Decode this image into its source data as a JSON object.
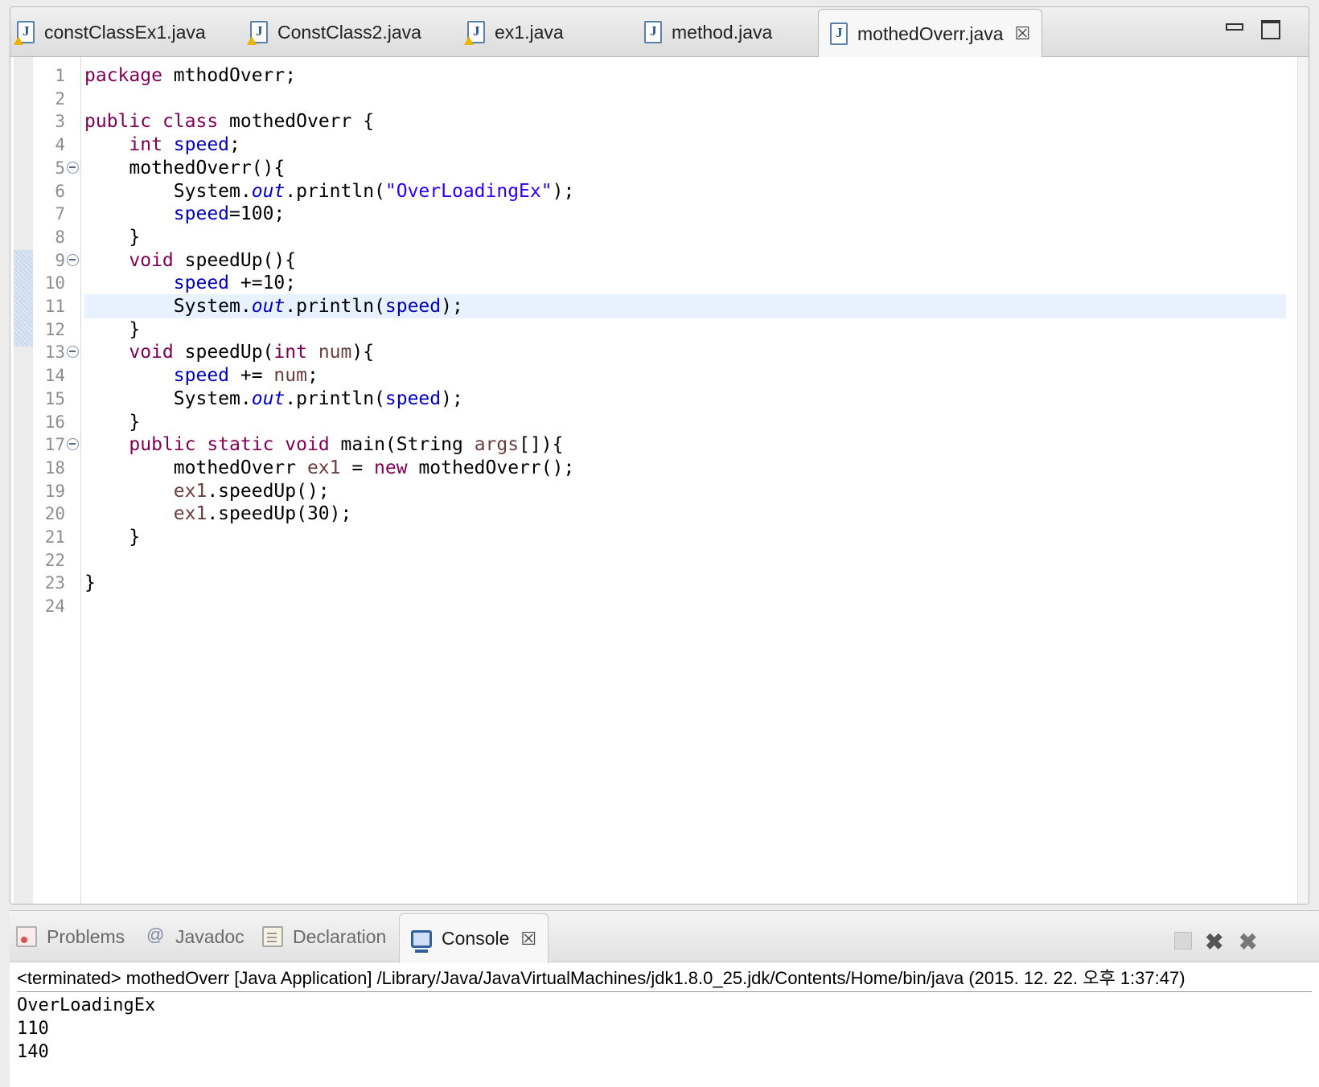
{
  "editor": {
    "tabs": [
      {
        "label": "constClassEx1.java",
        "warning": true
      },
      {
        "label": "ConstClass2.java",
        "warning": true
      },
      {
        "label": "ex1.java",
        "warning": true
      },
      {
        "label": "method.java",
        "warning": false
      },
      {
        "label": "mothedOverr.java",
        "active": true
      }
    ],
    "close_glyph": "☒",
    "current_line": 11,
    "line_numbers": [
      "1",
      "2",
      "3",
      "4",
      "5",
      "6",
      "7",
      "8",
      "9",
      "10",
      "11",
      "12",
      "13",
      "14",
      "15",
      "16",
      "17",
      "18",
      "19",
      "20",
      "21",
      "22",
      "23",
      "24"
    ],
    "folded_lines": [
      5,
      9,
      13,
      17
    ],
    "code": [
      [
        {
          "t": "package",
          "c": "kw"
        },
        {
          "t": " mthodOverr;"
        }
      ],
      [],
      [
        {
          "t": "public",
          "c": "kw"
        },
        {
          "t": " "
        },
        {
          "t": "class",
          "c": "kw"
        },
        {
          "t": " mothedOverr {"
        }
      ],
      [
        {
          "t": "    "
        },
        {
          "t": "int",
          "c": "kw"
        },
        {
          "t": " "
        },
        {
          "t": "speed",
          "c": "fld"
        },
        {
          "t": ";"
        }
      ],
      [
        {
          "t": "    mothedOverr(){"
        }
      ],
      [
        {
          "t": "        System."
        },
        {
          "t": "out",
          "c": "sfld"
        },
        {
          "t": ".println("
        },
        {
          "t": "\"OverLoadingEx\"",
          "c": "str"
        },
        {
          "t": ");"
        }
      ],
      [
        {
          "t": "        "
        },
        {
          "t": "speed",
          "c": "fld"
        },
        {
          "t": "=100;"
        }
      ],
      [
        {
          "t": "    }"
        }
      ],
      [
        {
          "t": "    "
        },
        {
          "t": "void",
          "c": "kw"
        },
        {
          "t": " speedUp(){"
        }
      ],
      [
        {
          "t": "        "
        },
        {
          "t": "speed",
          "c": "fld"
        },
        {
          "t": " +=10;"
        }
      ],
      [
        {
          "t": "        System."
        },
        {
          "t": "out",
          "c": "sfld"
        },
        {
          "t": ".println("
        },
        {
          "t": "speed",
          "c": "fld"
        },
        {
          "t": ");"
        }
      ],
      [
        {
          "t": "    }"
        }
      ],
      [
        {
          "t": "    "
        },
        {
          "t": "void",
          "c": "kw"
        },
        {
          "t": " speedUp("
        },
        {
          "t": "int",
          "c": "kw"
        },
        {
          "t": " "
        },
        {
          "t": "num",
          "c": "var"
        },
        {
          "t": "){"
        }
      ],
      [
        {
          "t": "        "
        },
        {
          "t": "speed",
          "c": "fld"
        },
        {
          "t": " += "
        },
        {
          "t": "num",
          "c": "var"
        },
        {
          "t": ";"
        }
      ],
      [
        {
          "t": "        System."
        },
        {
          "t": "out",
          "c": "sfld"
        },
        {
          "t": ".println("
        },
        {
          "t": "speed",
          "c": "fld"
        },
        {
          "t": ");"
        }
      ],
      [
        {
          "t": "    }"
        }
      ],
      [
        {
          "t": "    "
        },
        {
          "t": "public",
          "c": "kw"
        },
        {
          "t": " "
        },
        {
          "t": "static",
          "c": "kw"
        },
        {
          "t": " "
        },
        {
          "t": "void",
          "c": "kw"
        },
        {
          "t": " main(String "
        },
        {
          "t": "args",
          "c": "var"
        },
        {
          "t": "[]){"
        }
      ],
      [
        {
          "t": "        mothedOverr "
        },
        {
          "t": "ex1",
          "c": "var"
        },
        {
          "t": " = "
        },
        {
          "t": "new",
          "c": "kw"
        },
        {
          "t": " mothedOverr();"
        }
      ],
      [
        {
          "t": "        "
        },
        {
          "t": "ex1",
          "c": "var"
        },
        {
          "t": ".speedUp();"
        }
      ],
      [
        {
          "t": "        "
        },
        {
          "t": "ex1",
          "c": "var"
        },
        {
          "t": ".speedUp(30);"
        }
      ],
      [
        {
          "t": "    }"
        }
      ],
      [],
      [
        {
          "t": "}"
        }
      ],
      []
    ]
  },
  "console": {
    "tabs": {
      "problems": "Problems",
      "javadoc": "Javadoc",
      "declaration": "Declaration",
      "console": "Console"
    },
    "close_glyph": "☒",
    "terminate_glyph": "✖",
    "remove_all_glyph": "✖",
    "status": "<terminated> mothedOverr [Java Application] /Library/Java/JavaVirtualMachines/jdk1.8.0_25.jdk/Contents/Home/bin/java (2015. 12. 22. 오후 1:37:47)",
    "output": [
      "OverLoadingEx",
      "110",
      "140"
    ]
  }
}
